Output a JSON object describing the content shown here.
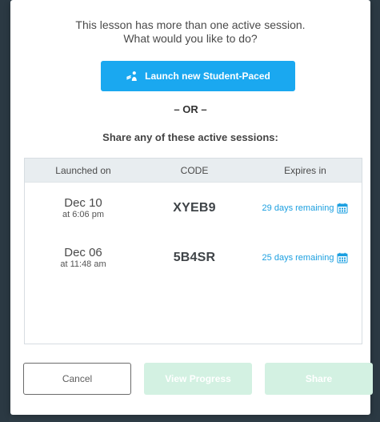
{
  "dialog": {
    "prompt_line_1": "This lesson has more than one active session.",
    "prompt_line_2": "What would you like to do?",
    "launch_label": "Launch new Student-Paced",
    "or_label": "– OR –",
    "share_heading": "Share any of these active sessions:"
  },
  "table": {
    "headers": [
      "Launched on",
      "CODE",
      "Expires in"
    ],
    "rows": [
      {
        "date": "Dec 10",
        "time": "at 6:06 pm",
        "code": "XYEB9",
        "expires": "29 days remaining"
      },
      {
        "date": "Dec 06",
        "time": "at 11:48 am",
        "code": "5B4SR",
        "expires": "25 days remaining"
      }
    ]
  },
  "footer": {
    "cancel_label": "Cancel",
    "view_progress_label": "View Progress",
    "share_label": "Share"
  },
  "icons": {
    "launch": "student-icon",
    "calendar": "calendar-icon"
  },
  "colors": {
    "primary": "#1aa8f0",
    "link": "#1b9fe0",
    "disabled_action": "#d3f1e2",
    "backdrop": "#2f3d47"
  }
}
